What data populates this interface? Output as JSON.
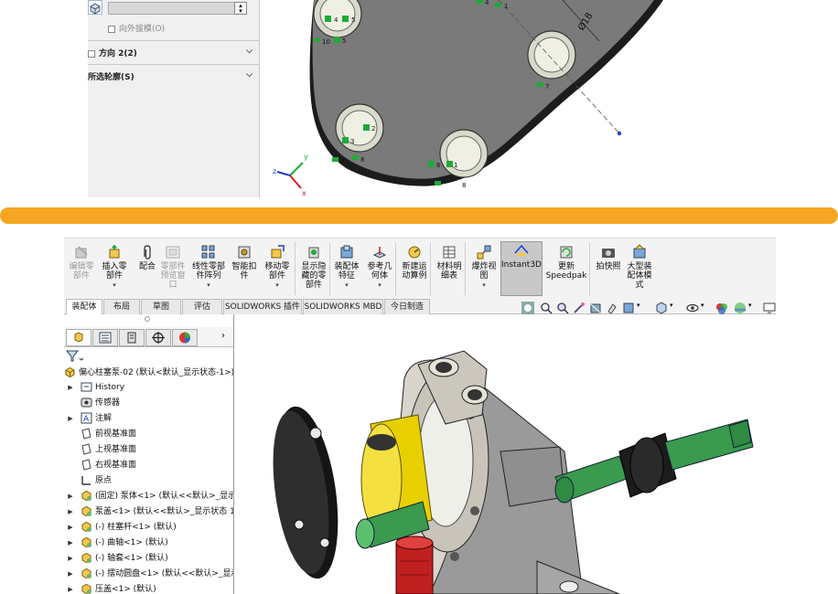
{
  "top_panel": {
    "draft_outward_label": "向外拔模(O)",
    "direction2_label": "方向 2(2)",
    "selected_contours_label": "所选轮廓(S)"
  },
  "sketch": {
    "dimension_label": "Ø18",
    "relations": [
      {
        "n": "4"
      },
      {
        "n": "5"
      },
      {
        "n": "10"
      },
      {
        "n": "5"
      },
      {
        "n": "4"
      },
      {
        "n": "1"
      },
      {
        "n": "7"
      },
      {
        "n": "2"
      },
      {
        "n": "3"
      },
      {
        "n": "9"
      },
      {
        "n": "8"
      },
      {
        "n": "6"
      },
      {
        "n": "1"
      },
      {
        "n": "8"
      }
    ],
    "triad": {
      "x": "x",
      "y": "y",
      "z": "z"
    }
  },
  "ribbon": {
    "buttons": [
      {
        "label": "编辑零\n部件",
        "disabled": true
      },
      {
        "label": "插入零\n部件",
        "disabled": false
      },
      {
        "label": "配合",
        "disabled": false
      },
      {
        "label": "零部件\n预览窗\n口",
        "disabled": true
      },
      {
        "label": "线性零部\n件阵列",
        "disabled": false
      },
      {
        "label": "智能扣\n件",
        "disabled": false
      },
      {
        "label": "移动零\n部件",
        "disabled": false
      },
      {
        "label": "显示隐\n藏的零\n部件",
        "disabled": false
      },
      {
        "label": "装配体\n特征",
        "disabled": false
      },
      {
        "label": "参考几\n何体",
        "disabled": false
      },
      {
        "label": "新建运\n动算例",
        "disabled": false
      },
      {
        "label": "材料明\n细表",
        "disabled": false
      },
      {
        "label": "爆炸视\n图",
        "disabled": false
      },
      {
        "label": "Instant3D",
        "disabled": false
      },
      {
        "label": "更新\nSpeedpak",
        "disabled": false
      },
      {
        "label": "拍快照",
        "disabled": false
      },
      {
        "label": "大型装\n配体模\n式",
        "disabled": false
      }
    ]
  },
  "tabs": [
    "装配体",
    "布局",
    "草图",
    "评估",
    "SOLIDWORKS 插件",
    "SOLIDWORKS MBD",
    "今日制造"
  ],
  "tree": {
    "root": "偏心柱塞泵-02 (默认<默认_显示状态-1>)",
    "items": [
      {
        "label": "History",
        "arrow": "▶",
        "indent": 1,
        "icon": "history-icon"
      },
      {
        "label": "传感器",
        "arrow": "",
        "indent": 1,
        "icon": "sensor-icon"
      },
      {
        "label": "注解",
        "arrow": "▶",
        "indent": 1,
        "icon": "annotation-icon"
      },
      {
        "label": "前视基准面",
        "arrow": "",
        "indent": 1,
        "icon": "plane-icon"
      },
      {
        "label": "上视基准面",
        "arrow": "",
        "indent": 1,
        "icon": "plane-icon"
      },
      {
        "label": "右视基准面",
        "arrow": "",
        "indent": 1,
        "icon": "plane-icon"
      },
      {
        "label": "原点",
        "arrow": "",
        "indent": 1,
        "icon": "origin-icon"
      },
      {
        "label": "(固定) 泵体<1> (默认<<默认>_显示状",
        "arrow": "▶",
        "indent": 1,
        "icon": "part-icon"
      },
      {
        "label": "泵盖<1> (默认<<默认>_显示状态 1>",
        "arrow": "▶",
        "indent": 1,
        "icon": "part-icon"
      },
      {
        "label": "(-) 柱塞杆<1> (默认)",
        "arrow": "▶",
        "indent": 1,
        "icon": "part-icon"
      },
      {
        "label": "(-) 曲轴<1> (默认)",
        "arrow": "▶",
        "indent": 1,
        "icon": "part-icon"
      },
      {
        "label": "(-) 轴套<1> (默认)",
        "arrow": "▶",
        "indent": 1,
        "icon": "part-icon"
      },
      {
        "label": "(-) 摆动圆盘<1> (默认<<默认>_显示",
        "arrow": "▶",
        "indent": 1,
        "icon": "part-icon"
      },
      {
        "label": "压盖<1> (默认)",
        "arrow": "▶",
        "indent": 1,
        "icon": "part-icon"
      }
    ]
  },
  "colors": {
    "accent_orange": "#f6a622",
    "relation_green": "#1faa3a",
    "part_yellow": "#e8d000",
    "part_green": "#3a9a4e",
    "part_red": "#c02020",
    "part_black": "#2a2a2a"
  }
}
